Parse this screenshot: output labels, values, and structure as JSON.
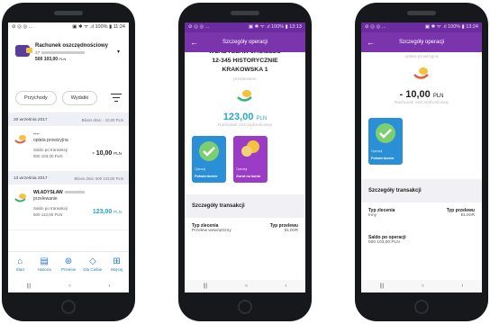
{
  "phone1": {
    "status_left": "⊘ ◎ ◎ ...",
    "status_right": "▣ ✱ ᯤ .ıl 100% ▮ 11:24",
    "account": {
      "name": "Rachunek oszczędnościowy",
      "number_prefix": "37",
      "balance": "500 103,00",
      "currency": "PLN"
    },
    "filters": {
      "income_label": "Przychody",
      "expense_label": "Wydatki"
    },
    "days": [
      {
        "date": "20 września 2017",
        "summary": "Bilans dnia: - 10,00 PLN",
        "tx": {
          "title": "----",
          "subtitle": "opłata prowizyjna",
          "balance_label": "Saldo po transakcji",
          "balance_value": "500 103,00 PLN",
          "amount": "- 10,00",
          "currency": "PLN"
        }
      },
      {
        "date": "13 września 2017",
        "summary": "Bilans dnia: 500 103,00 PLN",
        "tx": {
          "title": "WŁADYSŁAW",
          "subtitle": "przelewanie",
          "balance_label": "Saldo po transakcji",
          "balance_value": "500 113,00 PLN",
          "amount": "123,00",
          "currency": "PLN"
        }
      }
    ],
    "nav": [
      {
        "label": "Start",
        "icon": "home-icon",
        "glyph": "⌂"
      },
      {
        "label": "Historia",
        "icon": "history-icon",
        "glyph": "▤"
      },
      {
        "label": "Przelew",
        "icon": "transfer-icon",
        "glyph": "⊛"
      },
      {
        "label": "Dla Ciebie",
        "icon": "tag-icon",
        "glyph": "◇"
      },
      {
        "label": "Więcej",
        "icon": "grid-icon",
        "glyph": "⊞"
      }
    ]
  },
  "phone2": {
    "status_left": "⊘ ◎ ◎ ...",
    "status_right": "▣ ✱ ᯤ .ıl 100% ▮ 13:13",
    "header_title": "Szczegóły operacji",
    "counterparty": [
      "WŁADYSŁAW JAGIEŁŁO",
      "12-345 HISTORYCZNIE",
      "KRAKOWSKA 1"
    ],
    "desc": "przelewanie",
    "amount": "123,00",
    "currency": "PLN",
    "account": "Rachunek oszczędnościowy",
    "tiles": [
      {
        "desc": "Operacji",
        "label": "Potwierdzenie"
      },
      {
        "desc": "Operacji",
        "label": "Zwrot na konto"
      }
    ],
    "section_title": "Szczegóły transakcji",
    "type_order_label": "Typ zlecenia",
    "type_order_value": "Przelew wewnętrzny",
    "type_transfer_label": "Typ przelewu",
    "type_transfer_value": "ELIXIR"
  },
  "phone3": {
    "status_left": "⊘ ◎ ◎ ...",
    "status_right": "▣ ✱ ᯤ .ıl 100% ▮ 13:24",
    "header_title": "Szczegóły operacji",
    "desc": "opłata prowizyjna",
    "amount": "- 10,00",
    "currency": "PLN",
    "account": "Rachunek oszczędnościowy",
    "tile": {
      "desc": "Operacji",
      "label": "Potwierdzenie"
    },
    "section_title": "Szczegóły transakcji",
    "type_order_label": "Typ zlecenia",
    "type_order_value": "Inny",
    "type_transfer_label": "Typ przelewu",
    "type_transfer_value": "ELIXIR",
    "balance_label": "Saldo po operacji",
    "balance_value": "500 103,00 PLN"
  },
  "android_nav": {
    "recent": "|||",
    "home": "○",
    "back": "‹"
  },
  "colors": {
    "brand": "#7a35ad",
    "accent": "#2aa5c9",
    "tile_blue": "#2a8fd6",
    "tile_purple": "#9a3cc6"
  }
}
